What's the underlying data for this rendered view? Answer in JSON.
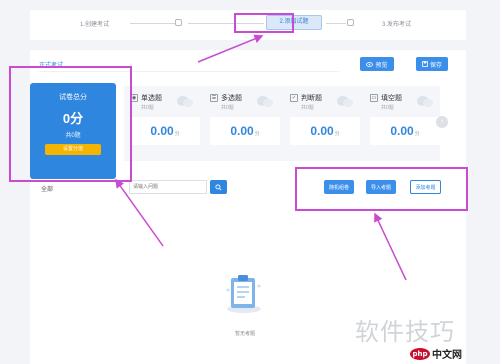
{
  "steps": [
    {
      "label": "1.创建考试"
    },
    {
      "label": "2.添加试题"
    },
    {
      "label": "3.发布考试"
    }
  ],
  "tabs": {
    "exam_label": "正式考试"
  },
  "toolbar": {
    "preview_label": "预览",
    "save_label": "保存",
    "preview_icon": "eye-icon",
    "save_icon": "floppy-icon"
  },
  "total": {
    "title": "试卷总分",
    "value": "0分",
    "count": "共0题",
    "button_label": "设置分值"
  },
  "question_types": [
    {
      "icon": "radio-icon",
      "label": "单选题",
      "count": "共0题",
      "score": "0.00",
      "unit": "分"
    },
    {
      "icon": "checkbox-icon",
      "label": "多选题",
      "count": "共0题",
      "score": "0.00",
      "unit": "分"
    },
    {
      "icon": "judge-icon",
      "label": "判断题",
      "count": "共0题",
      "score": "0.00",
      "unit": "分"
    },
    {
      "icon": "fill-icon",
      "label": "填空题",
      "count": "共0题",
      "score": "0.00",
      "unit": "分"
    }
  ],
  "filter": {
    "label": "全部",
    "search_placeholder": "请输入问题"
  },
  "actions": {
    "random_label": "随机组卷",
    "import_label": "导入考题",
    "add_label": "添加考题"
  },
  "empty": {
    "text": "暂无考题"
  },
  "watermark": {
    "site": "软件技巧",
    "logo_php": "php",
    "logo_cn": "中文网"
  },
  "colors": {
    "accent": "#2e86de",
    "button": "#3b8fea",
    "highlight": "#c94bd1",
    "warning": "#f5b400"
  }
}
